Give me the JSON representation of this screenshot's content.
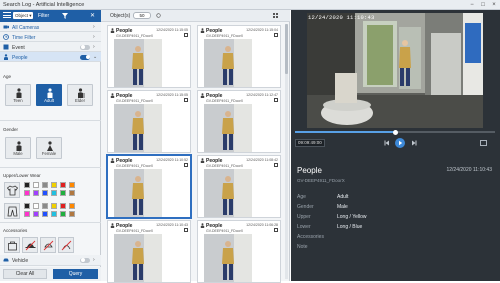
{
  "window": {
    "title": "Search Log - Artificial Intelligence",
    "minimize": "−",
    "maximize": "□",
    "close": "×"
  },
  "filter": {
    "mode": "Object ▾",
    "label": "Filter",
    "close": "✕"
  },
  "sections": {
    "all_cameras": "All Cameras",
    "time_filter": "Time Filter",
    "event": "Event",
    "people": "People",
    "vehicle": "Vehicle"
  },
  "age": {
    "label": "Age",
    "options": [
      "Teen",
      "Adult",
      "Elder"
    ],
    "selected": "Adult"
  },
  "gender": {
    "label": "Gender",
    "options": [
      "Male",
      "Female"
    ]
  },
  "wear": {
    "label": "Upper/Lower Wear",
    "colors": [
      "#222222",
      "#ffffff",
      "#8a8a8a",
      "#f0d000",
      "#e02020",
      "#ff8800",
      "#ff33cc",
      "#a040ff",
      "#2050ff",
      "#20c0e0",
      "#20b040",
      "#b07840"
    ]
  },
  "accessories": {
    "label": "Accessories",
    "icons": [
      "bag-icon",
      "hat-icon",
      "no-hat-icon",
      "no-bag-icon"
    ]
  },
  "buttons": {
    "clear_all": "Clear All",
    "query": "Query"
  },
  "results": {
    "header_label": "Object(s)",
    "header_select": "50",
    "cards": [
      {
        "name": "People",
        "time": "12/24/2020 11:15:05",
        "camera": "GV-DEEP4911_FDoorX"
      },
      {
        "name": "People",
        "time": "12/24/2020 11:15:04",
        "camera": "GV-DEEP4911_FDoorX"
      },
      {
        "name": "People",
        "time": "12/24/2020 11:15:05",
        "camera": "GV-DEEP4911_FDoorX"
      },
      {
        "name": "People",
        "time": "12/24/2020 11:12:47",
        "camera": "GV-DEEP4911_FDoorX"
      },
      {
        "name": "People",
        "time": "12/24/2020 11:10:52",
        "camera": "GV-DEEP4911_FDoorX"
      },
      {
        "name": "People",
        "time": "12/24/2020 11:08:42",
        "camera": "GV-DEEP4911_FDoorX"
      },
      {
        "name": "People",
        "time": "12/24/2020 11:10:43",
        "camera": "GV-DEEP4911_FDoorX"
      },
      {
        "name": "People",
        "time": "12/24/2020 11:06:28",
        "camera": "GV-DEEP4911_FDoorX"
      }
    ]
  },
  "player": {
    "osd": "12/24/2020 11:10:43",
    "time": "09:09:49:00",
    "progress": 0.5
  },
  "detail": {
    "title": "People",
    "time": "12/24/2020 11:10:43",
    "camera": "GV-DEEP4911_FDoorX",
    "rows": [
      {
        "key": "Age",
        "value": "Adult"
      },
      {
        "key": "Gender",
        "value": "Male"
      },
      {
        "key": "Upper",
        "value": "Long / Yellow"
      },
      {
        "key": "Lower",
        "value": "Long / Blue"
      },
      {
        "key": "Accessories",
        "value": ""
      },
      {
        "key": "Note",
        "value": ""
      }
    ]
  }
}
